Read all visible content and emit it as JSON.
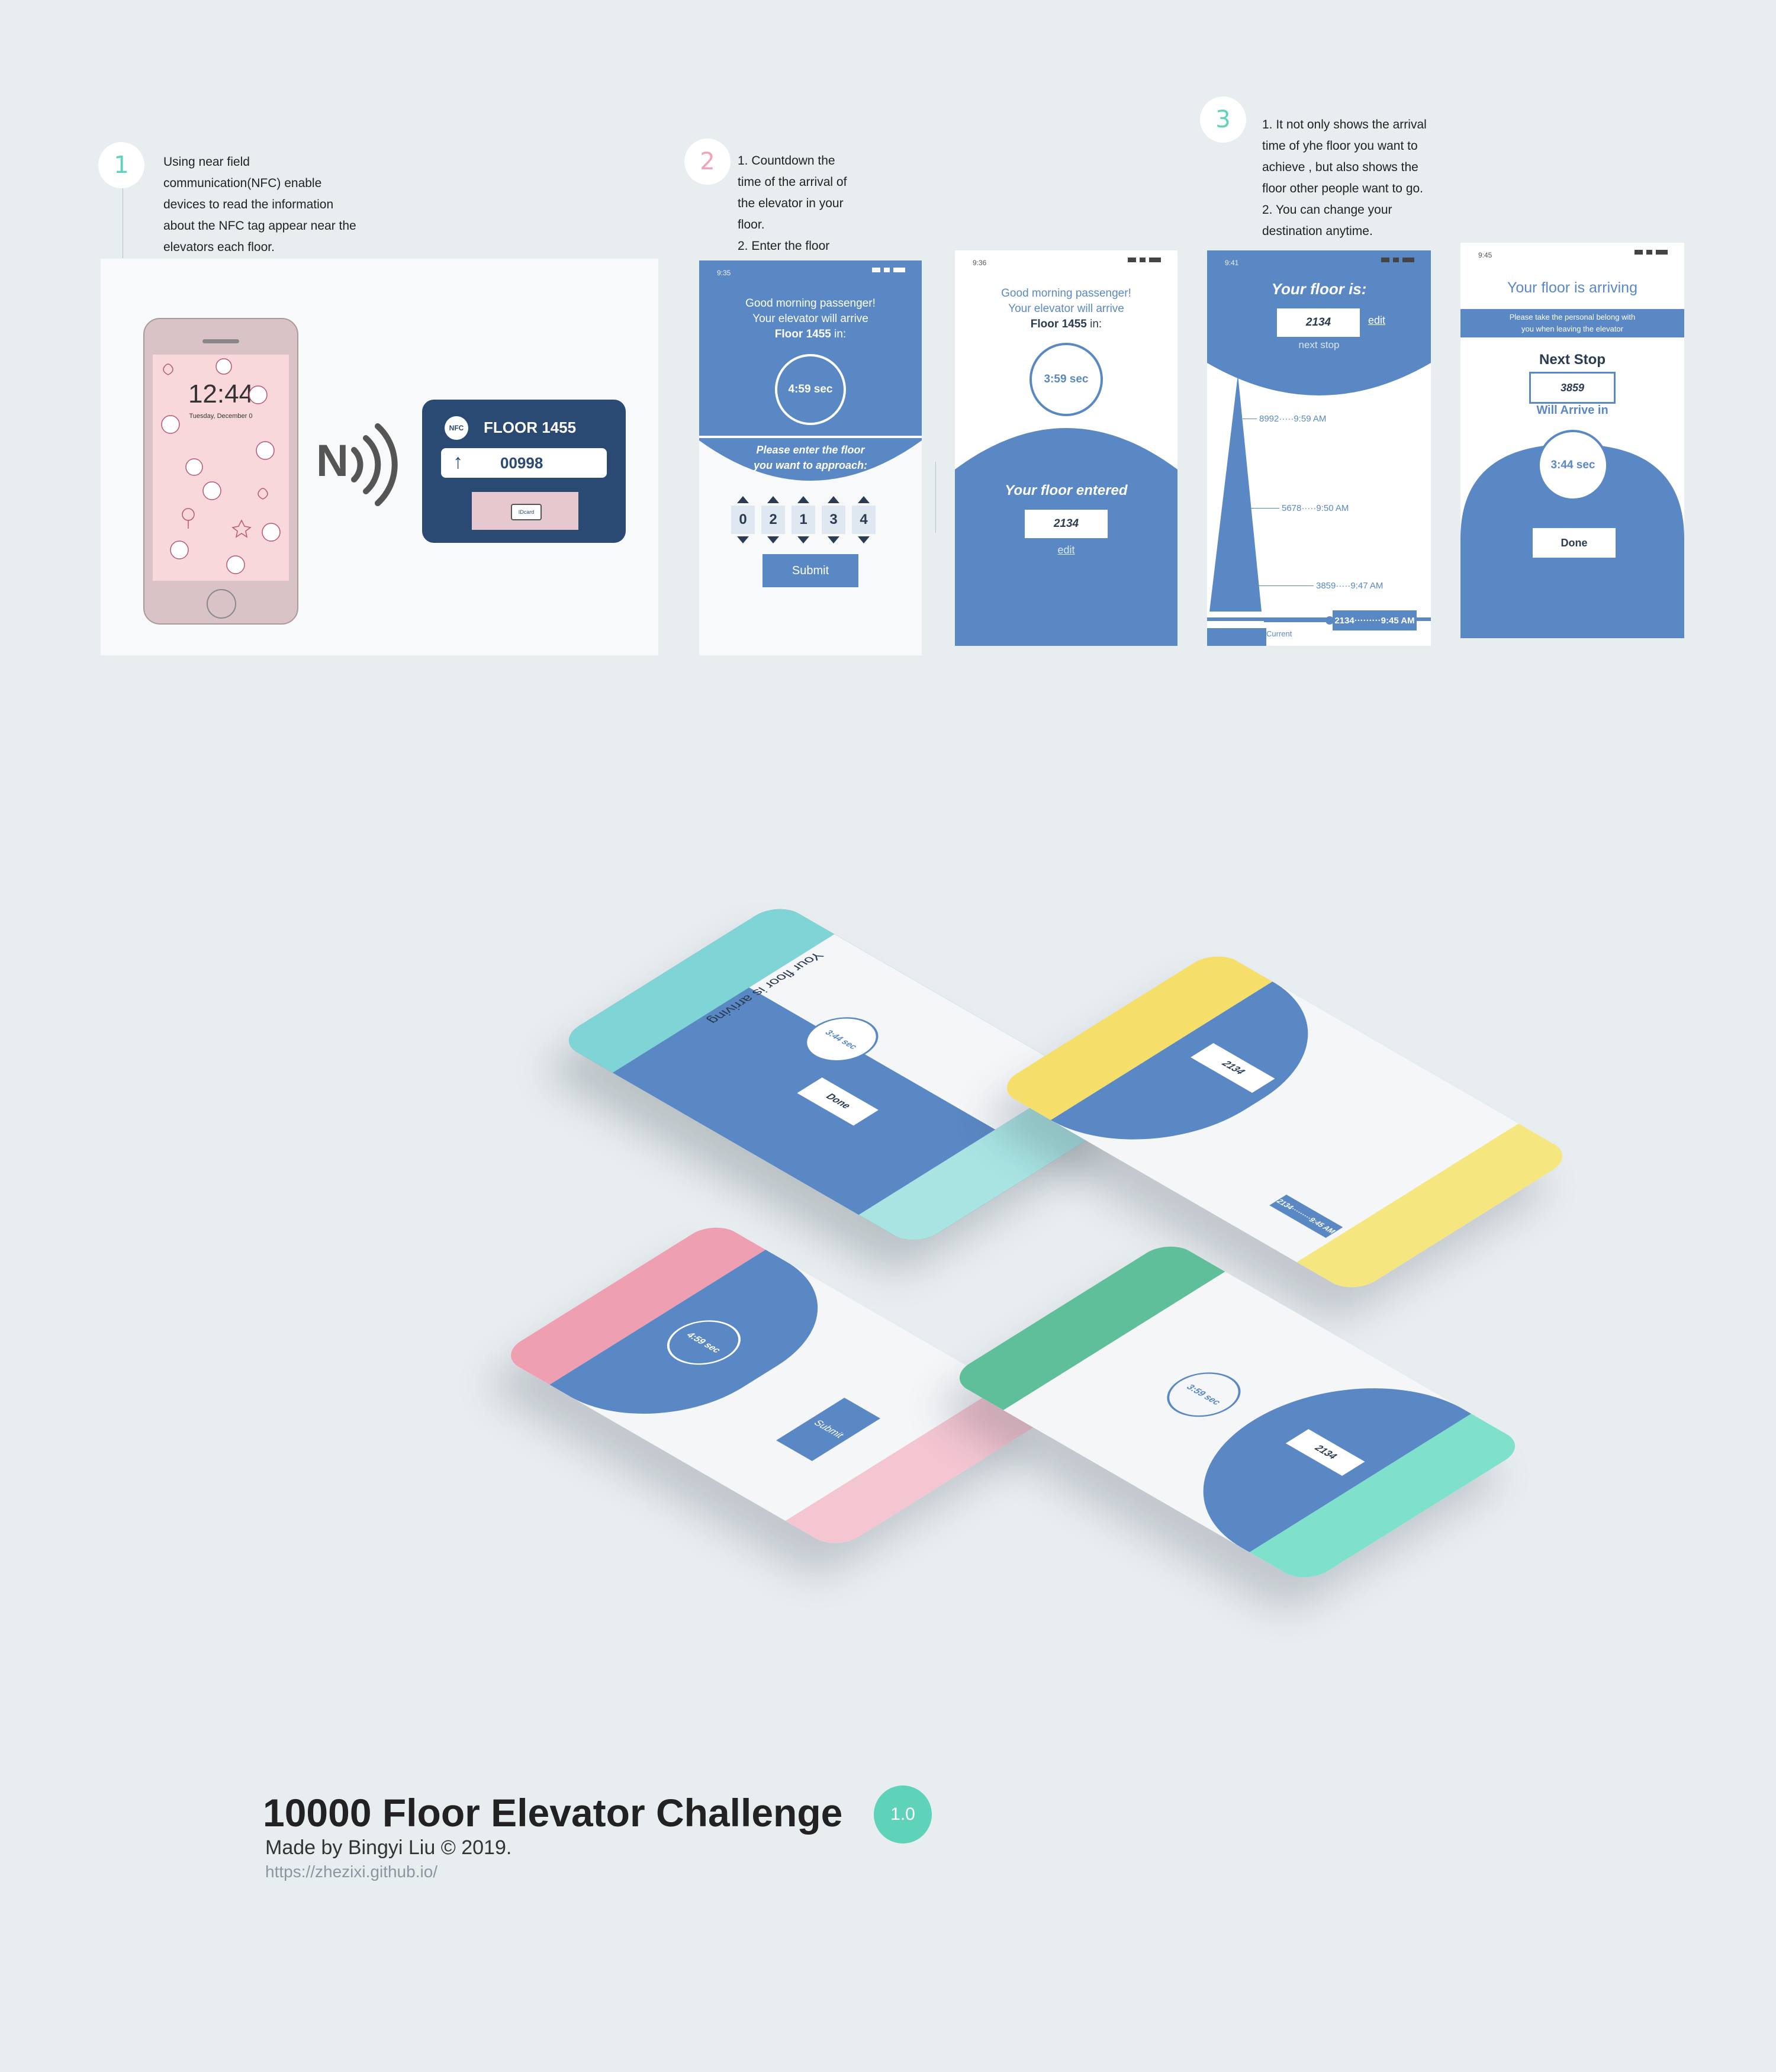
{
  "step1": {
    "number": "1",
    "desc": [
      "Using near field",
      "communication(NFC) enable",
      "devices to read the information",
      "about the NFC tag appear near the",
      "elevators each floor."
    ],
    "phone_time": "12:44",
    "phone_date": "Tuesday, December 0",
    "nfc_letter": "N",
    "nfc_badge": "NFC",
    "nfc_floor": "FLOOR 1455",
    "nfc_arrow": "↑",
    "nfc_code": "00998",
    "card_label": "IDcard"
  },
  "step2": {
    "number": "2",
    "desc": [
      "1. Countdown the",
      "time of the arrival of",
      "the elevator in your",
      "floor.",
      "2. Enter the floor"
    ]
  },
  "step3": {
    "number": "3",
    "desc": [
      "1. It not only shows the arrival",
      "time of yhe floor you want to",
      "achieve , but also shows the",
      "floor other people want to go.",
      "2. You can change your",
      "destination anytime."
    ]
  },
  "screenA": {
    "time": "9:35",
    "greeting": "Good morning passenger!",
    "line2": "Your elevator will arrive",
    "floor": "Floor 1455",
    "in": " in:",
    "timer": "4:59 sec",
    "prompt1": "Please enter the floor",
    "prompt2": "you want to approach:",
    "digits": [
      "0",
      "2",
      "1",
      "3",
      "4"
    ],
    "submit": "Submit"
  },
  "screenB": {
    "time": "9:36",
    "greeting": "Good morning passenger!",
    "line2": "Your elevator will arrive",
    "floor": "Floor 1455",
    "in": " in:",
    "timer": "3:59 sec",
    "entered": "Your floor entered",
    "value": "2134",
    "edit": "edit"
  },
  "screenC": {
    "time": "9:41",
    "title": "Your floor is:",
    "value": "2134",
    "edit": "edit",
    "next": "next stop",
    "stops": [
      {
        "label": "8992·····9:59 AM"
      },
      {
        "label": "5678·····9:50 AM"
      },
      {
        "label": "3859·····9:47 AM"
      }
    ],
    "current_label": "2134·········9:45 AM",
    "current": "Current"
  },
  "screenD": {
    "time": "9:45",
    "title": "Your floor is arriving",
    "notice1": "Please take the personal belong with",
    "notice2": "you when leaving the elevator",
    "next_stop": "Next Stop",
    "value": "3859",
    "will_arrive": "Will Arrive in",
    "timer": "3:44 sec",
    "done": "Done"
  },
  "footer": {
    "title": "10000 Floor Elevator Challenge",
    "version": "1.0",
    "credit": "Made by Bingyi Liu © 2019.",
    "url": "https://zhezixi.github.io/"
  },
  "colors": {
    "blue": "#5a88c4",
    "navy": "#2a4a73",
    "teal": "#5fd3b9",
    "pink": "#f2a3b6",
    "yellow": "#f5de6a",
    "green": "#5fbf9a"
  }
}
